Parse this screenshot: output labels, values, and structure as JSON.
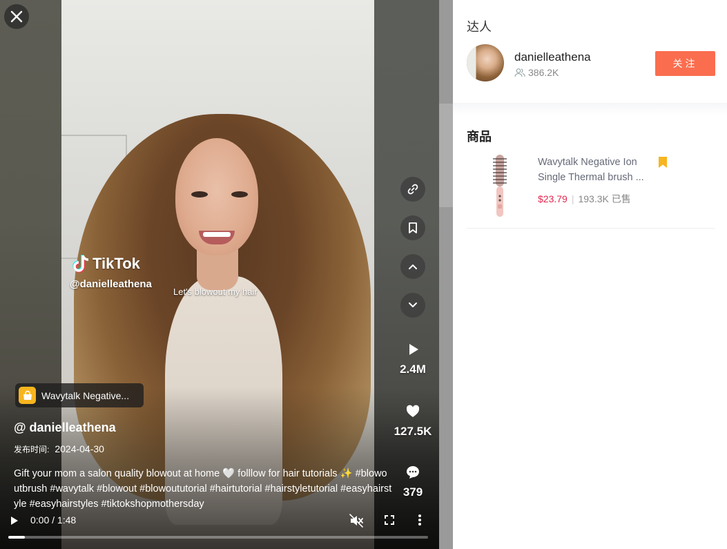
{
  "video": {
    "watermark_brand": "TikTok",
    "watermark_handle": "@danielleathena",
    "caption_overlay": "Let's blowout my hair",
    "product_chip": "Wavytalk Negative...",
    "author": "@ danielleathena",
    "publish_label": "发布时间:",
    "publish_date": "2024-04-30",
    "description": "Gift your mom a salon quality blowout at home 🤍 folllow for hair tutorials ✨ #blowoutbrush #wavytalk #blowout #blowoututorial #hairtutorial #hairstyletutorial #easyhairstyle #easyhairstyles #tiktokshopmothersday",
    "stats": {
      "plays": "2.4M",
      "likes": "127.5K",
      "comments": "379"
    },
    "time": "0:00 / 1:48",
    "progress": 0.04,
    "icons": [
      "close-icon",
      "link-icon",
      "bookmark-icon",
      "chevron-up-icon",
      "chevron-down-icon",
      "play-icon",
      "heart-icon",
      "comment-icon",
      "mute-icon",
      "fullscreen-icon",
      "more-icon",
      "shopping-bag-icon"
    ]
  },
  "panel": {
    "influencer_section": "达人",
    "influencer_name": "danielleathena",
    "influencer_fans": "386.2K",
    "follow_label": "关注",
    "goods_section": "商品",
    "product": {
      "name_line1": "Wavytalk Negative Ion",
      "name_line2": "Single Thermal brush ...",
      "price": "$23.79",
      "sold": "193.3K 已售"
    },
    "accent_color": "#fa6e4f",
    "price_color": "#e3284e",
    "bookmark_color": "#f7b51f"
  }
}
